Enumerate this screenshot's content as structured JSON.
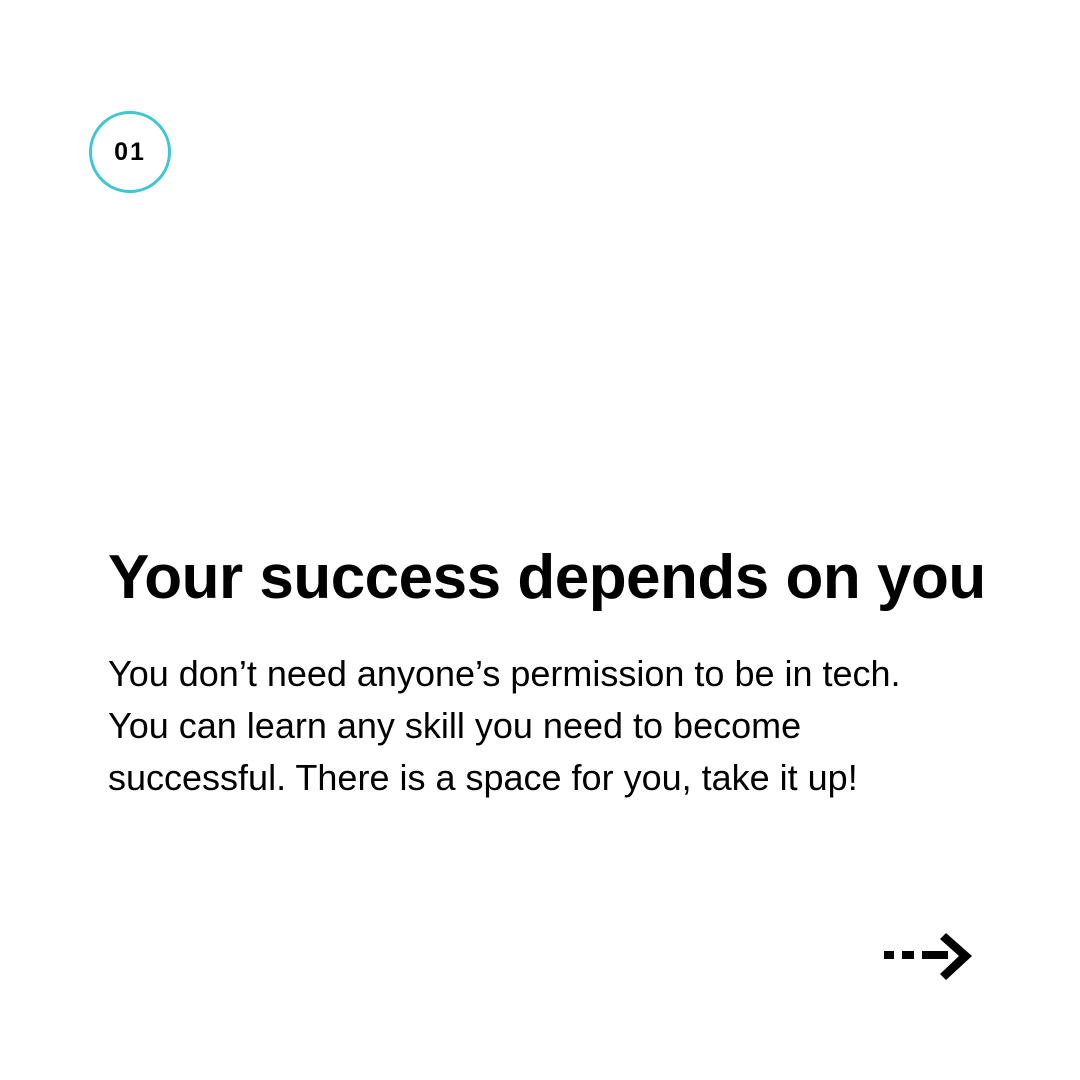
{
  "slide": {
    "number": "01",
    "accent_color": "#3fc6d3",
    "headline": "Your success depends on you",
    "body_lines": [
      "You don’t need anyone’s permission to be in tech.",
      "You can learn any skill you need to become",
      "successful. There is a space for you, take it up!"
    ],
    "next_icon": "dashed-arrow-right-icon"
  }
}
